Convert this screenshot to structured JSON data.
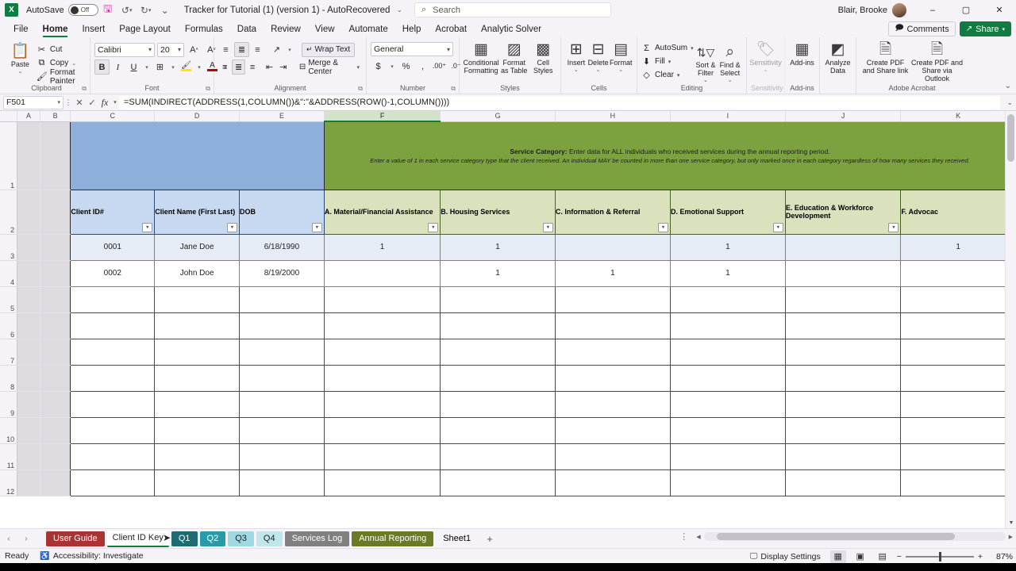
{
  "titlebar": {
    "app_logo": "excel-logo",
    "autosave_label": "AutoSave",
    "autosave_state": "Off",
    "save_icon": "save-icon",
    "undo_icon": "undo-icon",
    "redo_icon": "redo-icon",
    "customize_icon": "customize-quick-access-icon",
    "document_title": "Tracker for Tutorial (1) (version 1)  -  AutoRecovered",
    "title_chevron": "chevron-down-icon",
    "search_placeholder": "Search",
    "search_icon": "search-icon",
    "user_name": "Blair, Brooke",
    "minimize": "–",
    "restore": "▢",
    "close": "✕"
  },
  "ribbon": {
    "tabs": [
      {
        "label": "File",
        "active": false
      },
      {
        "label": "Home",
        "active": true
      },
      {
        "label": "Insert",
        "active": false
      },
      {
        "label": "Page Layout",
        "active": false
      },
      {
        "label": "Formulas",
        "active": false
      },
      {
        "label": "Data",
        "active": false
      },
      {
        "label": "Review",
        "active": false
      },
      {
        "label": "View",
        "active": false
      },
      {
        "label": "Automate",
        "active": false
      },
      {
        "label": "Help",
        "active": false
      },
      {
        "label": "Acrobat",
        "active": false
      },
      {
        "label": "Analytic Solver",
        "active": false
      }
    ],
    "comments_label": "Comments",
    "share_label": "Share",
    "collapse_icon": "chevron-up-icon",
    "groups": {
      "clipboard": {
        "label": "Clipboard",
        "paste": "Paste",
        "cut": "Cut",
        "copy": "Copy",
        "format_painter": "Format Painter"
      },
      "font": {
        "label": "Font",
        "font_name": "Calibri",
        "font_size": "20",
        "grow_font": "A",
        "shrink_font": "A",
        "bold": "B",
        "italic": "I",
        "underline": "U",
        "borders": "borders-icon",
        "fill_color": "fill-color-icon",
        "font_color": "font-color-icon"
      },
      "alignment": {
        "label": "Alignment",
        "wrap_text": "Wrap Text",
        "merge_center": "Merge & Center",
        "orientation": "orientation-icon",
        "indent_decrease": "decrease-indent-icon",
        "indent_increase": "increase-indent-icon"
      },
      "number": {
        "label": "Number",
        "format": "General",
        "currency": "$",
        "percent": "%",
        "comma": ",",
        "increase_decimal": "increase-decimal-icon",
        "decrease_decimal": "decrease-decimal-icon"
      },
      "styles": {
        "label": "Styles",
        "conditional_formatting": "Conditional Formatting",
        "format_as_table": "Format as Table",
        "cell_styles": "Cell Styles"
      },
      "cells": {
        "label": "Cells",
        "insert": "Insert",
        "delete": "Delete",
        "format": "Format"
      },
      "editing": {
        "label": "Editing",
        "autosum": "AutoSum",
        "fill": "Fill",
        "clear": "Clear",
        "sort_filter": "Sort & Filter",
        "find_select": "Find & Select"
      },
      "sensitivity": {
        "label": "Sensitivity",
        "button": "Sensitivity"
      },
      "addins": {
        "label": "Add-ins",
        "button": "Add-ins",
        "analyze": "Analyze Data"
      },
      "acrobat": {
        "label": "Adobe Acrobat",
        "create_share_link": "Create PDF and Share link",
        "create_share_outlook": "Create PDF and Share via Outlook"
      }
    }
  },
  "formula_bar": {
    "name_box": "F501",
    "cancel_icon": "cancel-icon",
    "enter_icon": "enter-icon",
    "function_icon": "insert-function-icon",
    "formula": "=SUM(INDIRECT(ADDRESS(1,COLUMN())&\":\"&ADDRESS(ROW()-1,COLUMN())))",
    "expand_icon": "expand-formula-bar-icon"
  },
  "grid": {
    "column_letters": [
      "A",
      "B",
      "C",
      "D",
      "E",
      "F",
      "G",
      "H",
      "I",
      "J",
      "K"
    ],
    "selected_column": "F",
    "row_numbers": [
      "1",
      "2",
      "3",
      "4",
      "5",
      "6",
      "7",
      "8",
      "9",
      "10",
      "11",
      "12"
    ],
    "banner_blue_text": "",
    "banner_green": {
      "line1_bold": "Service Category:",
      "line1_rest": " Enter data for ALL individuals who received services during the annual reporting period.",
      "line2": "Enter a value of 1 in each service category type that the client received. An individual MAY be counted in more than one service category, but only marked once in each category regardless of how many services they received."
    },
    "headers": [
      {
        "col": "C",
        "label": "Client ID#",
        "style": "blue"
      },
      {
        "col": "D",
        "label": "Client Name (First Last)",
        "style": "blue"
      },
      {
        "col": "E",
        "label": "DOB",
        "style": "blue"
      },
      {
        "col": "F",
        "label": "A. Material/Financial Assistance",
        "style": "green"
      },
      {
        "col": "G",
        "label": "B. Housing Services",
        "style": "green"
      },
      {
        "col": "H",
        "label": "C. Information & Referral",
        "style": "green"
      },
      {
        "col": "I",
        "label": "D. Emotional Support",
        "style": "green"
      },
      {
        "col": "J",
        "label": "E. Education & Workforce Development",
        "style": "green"
      },
      {
        "col": "K",
        "label": "F. Advocac",
        "style": "green"
      }
    ],
    "rows": [
      {
        "row": "3",
        "banded": true,
        "c": "0001",
        "d": "Jane Doe",
        "e": "6/18/1990",
        "f": "1",
        "g": "1",
        "h": "",
        "i": "1",
        "j": "",
        "k": "1"
      },
      {
        "row": "4",
        "banded": false,
        "c": "0002",
        "d": "John Doe",
        "e": "8/19/2000",
        "f": "",
        "g": "1",
        "h": "1",
        "i": "1",
        "j": "",
        "k": ""
      }
    ],
    "empty_rows": [
      "5",
      "6",
      "7",
      "8",
      "9",
      "10",
      "11",
      "12"
    ],
    "filter_icon": "filter-dropdown-icon"
  },
  "sheet_tabs": {
    "prev_icon": "previous-sheet-icon",
    "next_icon": "next-sheet-icon",
    "tabs": [
      {
        "label": "User Guide",
        "color": "#a33",
        "text": "#ffffff",
        "active": false
      },
      {
        "label": "Client ID Key",
        "color": "#ffffff",
        "text": "#1f1f1f",
        "active": true
      },
      {
        "label": "Q1",
        "color": "#1f6b73",
        "text": "#ffffff",
        "active": false
      },
      {
        "label": "Q2",
        "color": "#2a9aa8",
        "text": "#ffffff",
        "active": false
      },
      {
        "label": "Q3",
        "color": "#9fd8e0",
        "text": "#1f1f1f",
        "active": false
      },
      {
        "label": "Q4",
        "color": "#bfe6ec",
        "text": "#1f1f1f",
        "active": false
      },
      {
        "label": "Services Log",
        "color": "#808080",
        "text": "#ffffff",
        "active": false
      },
      {
        "label": "Annual Reporting",
        "color": "#6b7a24",
        "text": "#ffffff",
        "active": false
      },
      {
        "label": "Sheet1",
        "color": "transparent",
        "text": "#1f1f1f",
        "active": false
      }
    ],
    "add_sheet": "+"
  },
  "status_bar": {
    "state": "Ready",
    "accessibility": "Accessibility: Investigate",
    "accessibility_icon": "accessibility-icon",
    "display_settings": "Display Settings",
    "display_settings_icon": "display-settings-icon",
    "view_normal": "normal-view-icon",
    "view_pagelayout": "page-layout-view-icon",
    "view_pagebreak": "page-break-view-icon",
    "zoom_out": "−",
    "zoom_in": "+",
    "zoom_level": "87%"
  }
}
